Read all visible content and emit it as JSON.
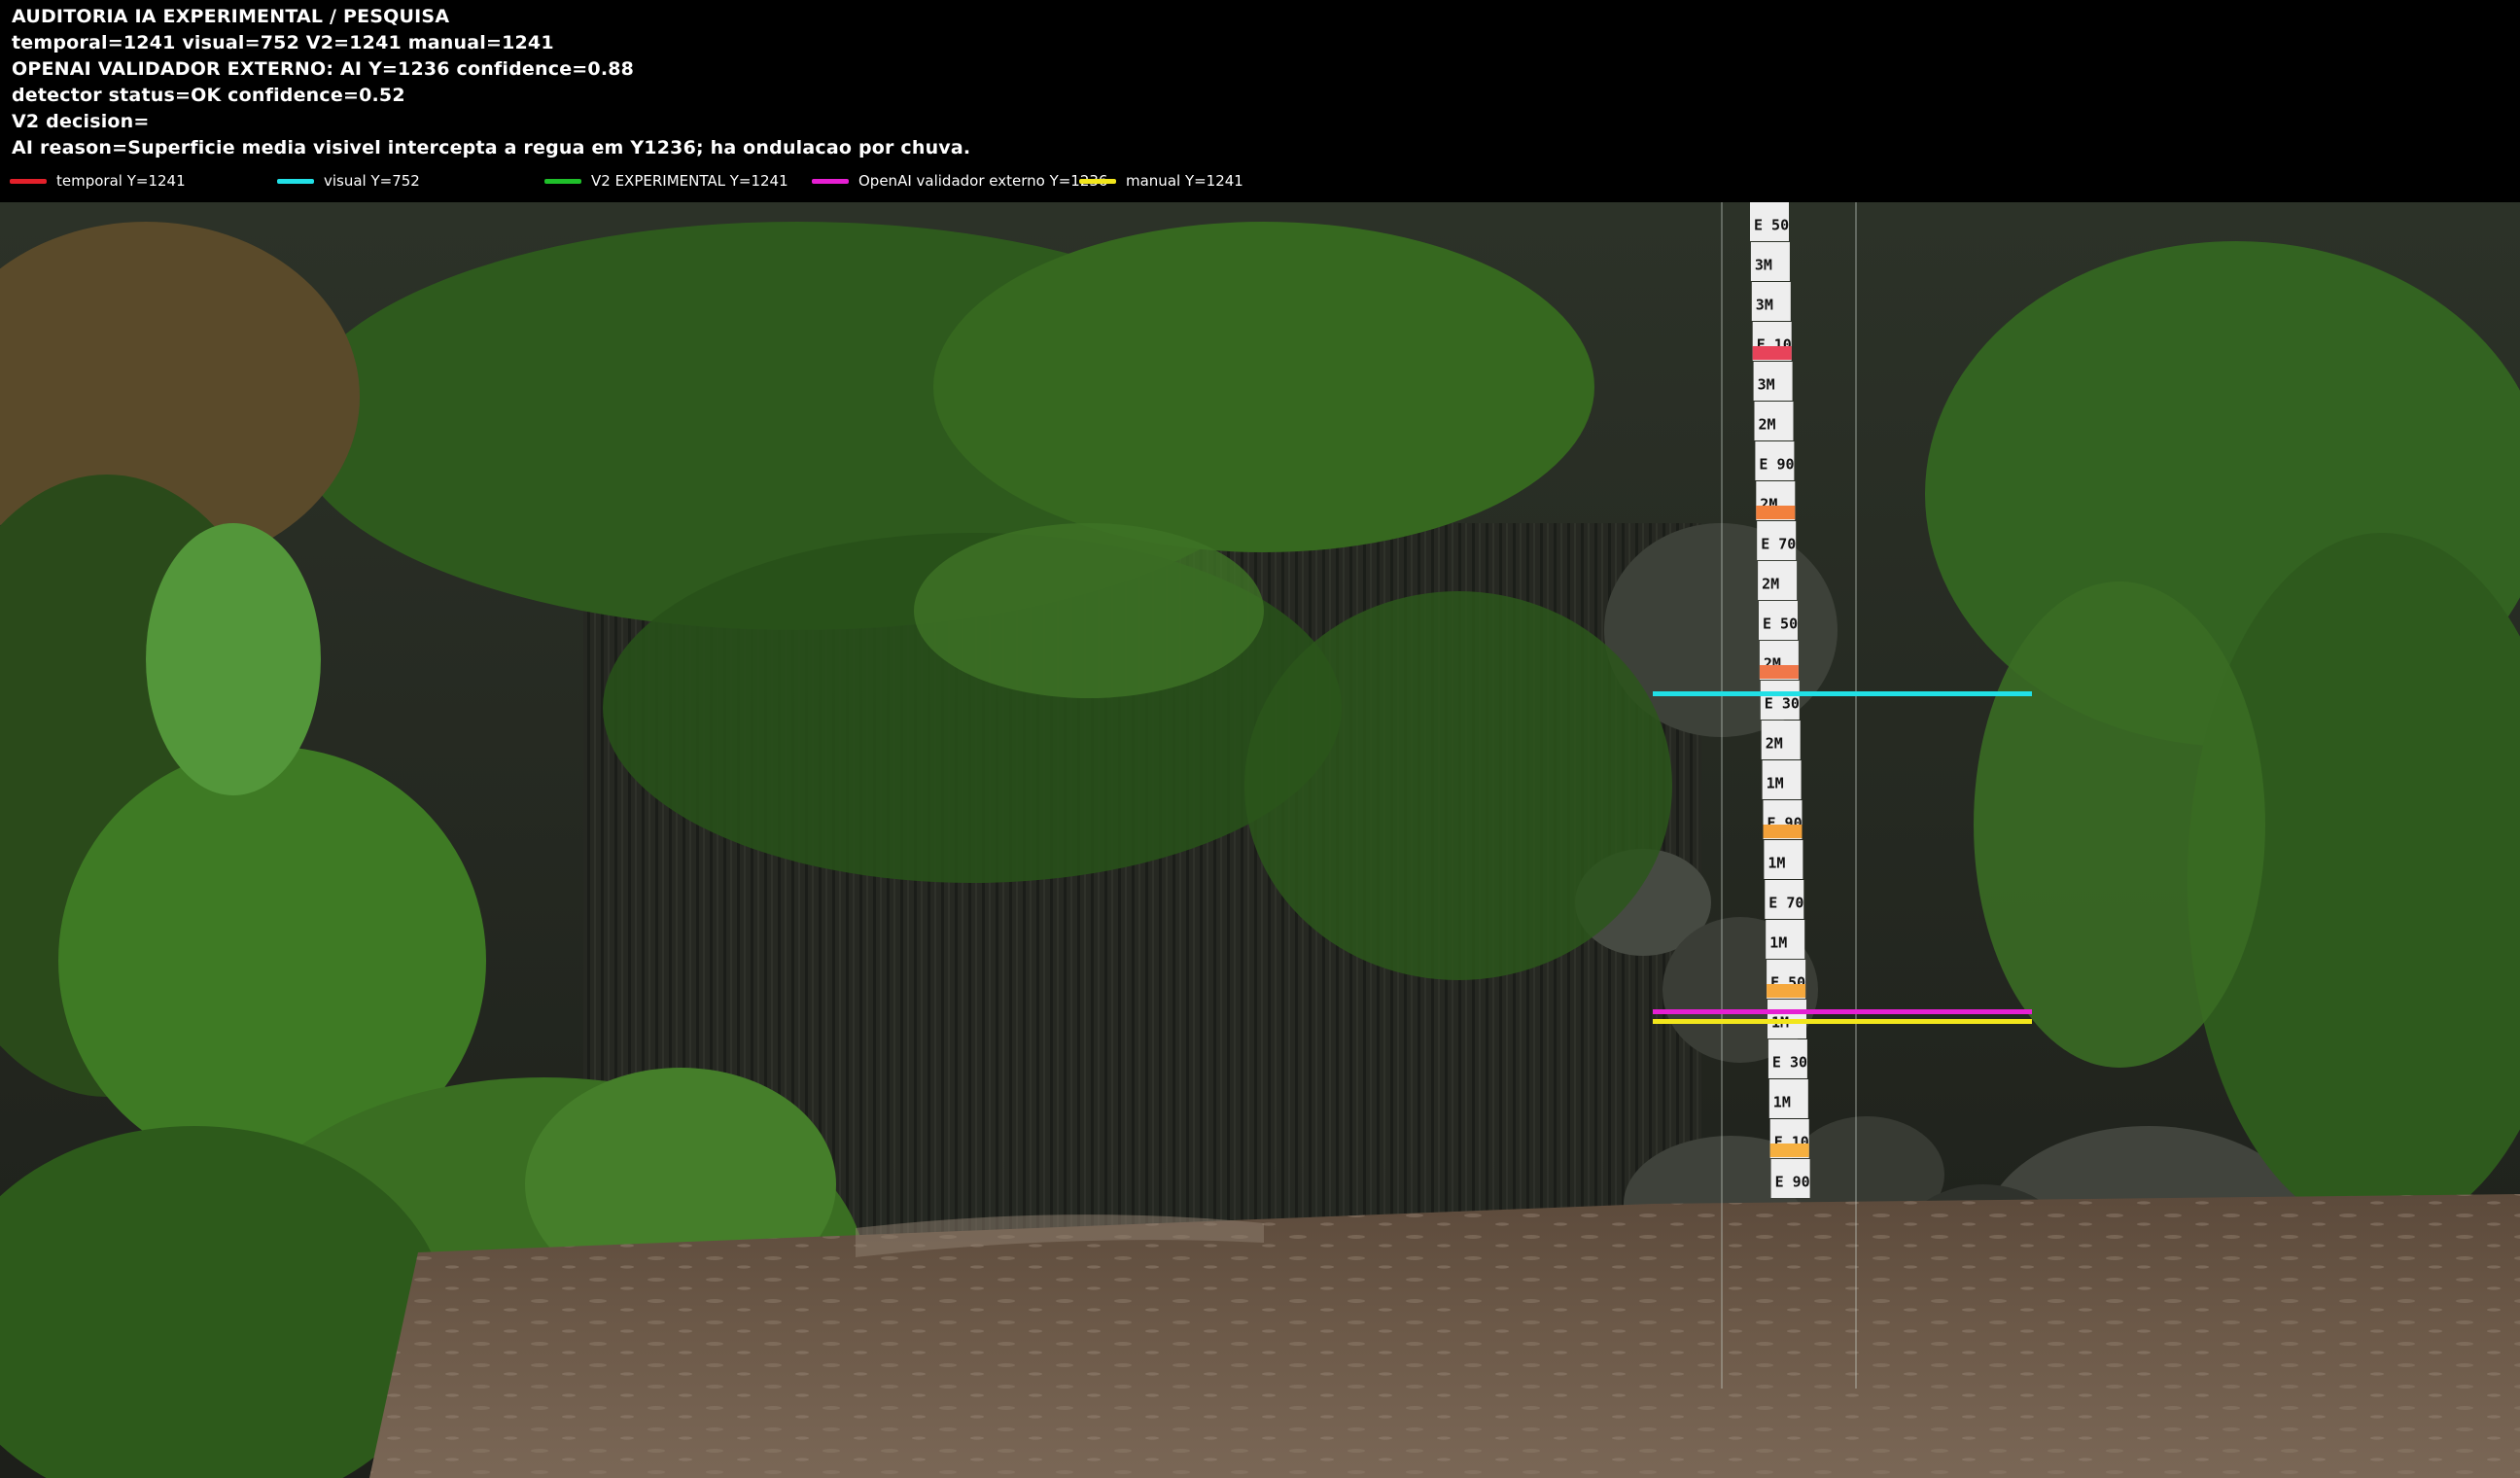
{
  "header": {
    "lines": [
      "AUDITORIA IA  EXPERIMENTAL / PESQUISA",
      "temporal=1241   visual=752   V2=1241   manual=1241",
      "OPENAI  VALIDADOR EXTERNO: AI Y=1236   confidence=0.88",
      "detector status=OK confidence=0.52",
      "V2 decision=",
      "AI reason=Superficie media visivel intercepta a regua em Y1236; ha ondulacao por chuva."
    ]
  },
  "legend": [
    {
      "label": "temporal Y=1241",
      "color": "#e3202a"
    },
    {
      "label": "visual Y=752",
      "color": "#21e0e6"
    },
    {
      "label": "V2 EXPERIMENTAL Y=1241",
      "color": "#1fbf2a"
    },
    {
      "label": "OpenAI validador externo Y=1236",
      "color": "#e61fd3"
    },
    {
      "label": "manual Y=1241",
      "color": "#f2e61c"
    }
  ],
  "markers": [
    {
      "name": "visual-level-line",
      "value_y": 752,
      "color": "#21e0e6"
    },
    {
      "name": "openai-level-line",
      "value_y": 1236,
      "color": "#e61fd3"
    },
    {
      "name": "manual-level-line",
      "value_y": 1241,
      "color": "#f2e61c"
    }
  ],
  "gauge": {
    "segments": [
      "E 50",
      "3M",
      "3M",
      "E 10",
      "3M",
      "2M",
      "E 90",
      "2M",
      "E 70",
      "2M",
      "E 50",
      "2M",
      "E 30",
      "2M",
      "1M",
      "E 90",
      "1M",
      "E 70",
      "1M",
      "E 50",
      "1M",
      "E 30",
      "1M",
      "E 10",
      "E 90"
    ]
  },
  "colors": {
    "background": "#000000",
    "header_text": "#ffffff",
    "water": "#6a5848",
    "foliage": "#2f5a1f"
  }
}
